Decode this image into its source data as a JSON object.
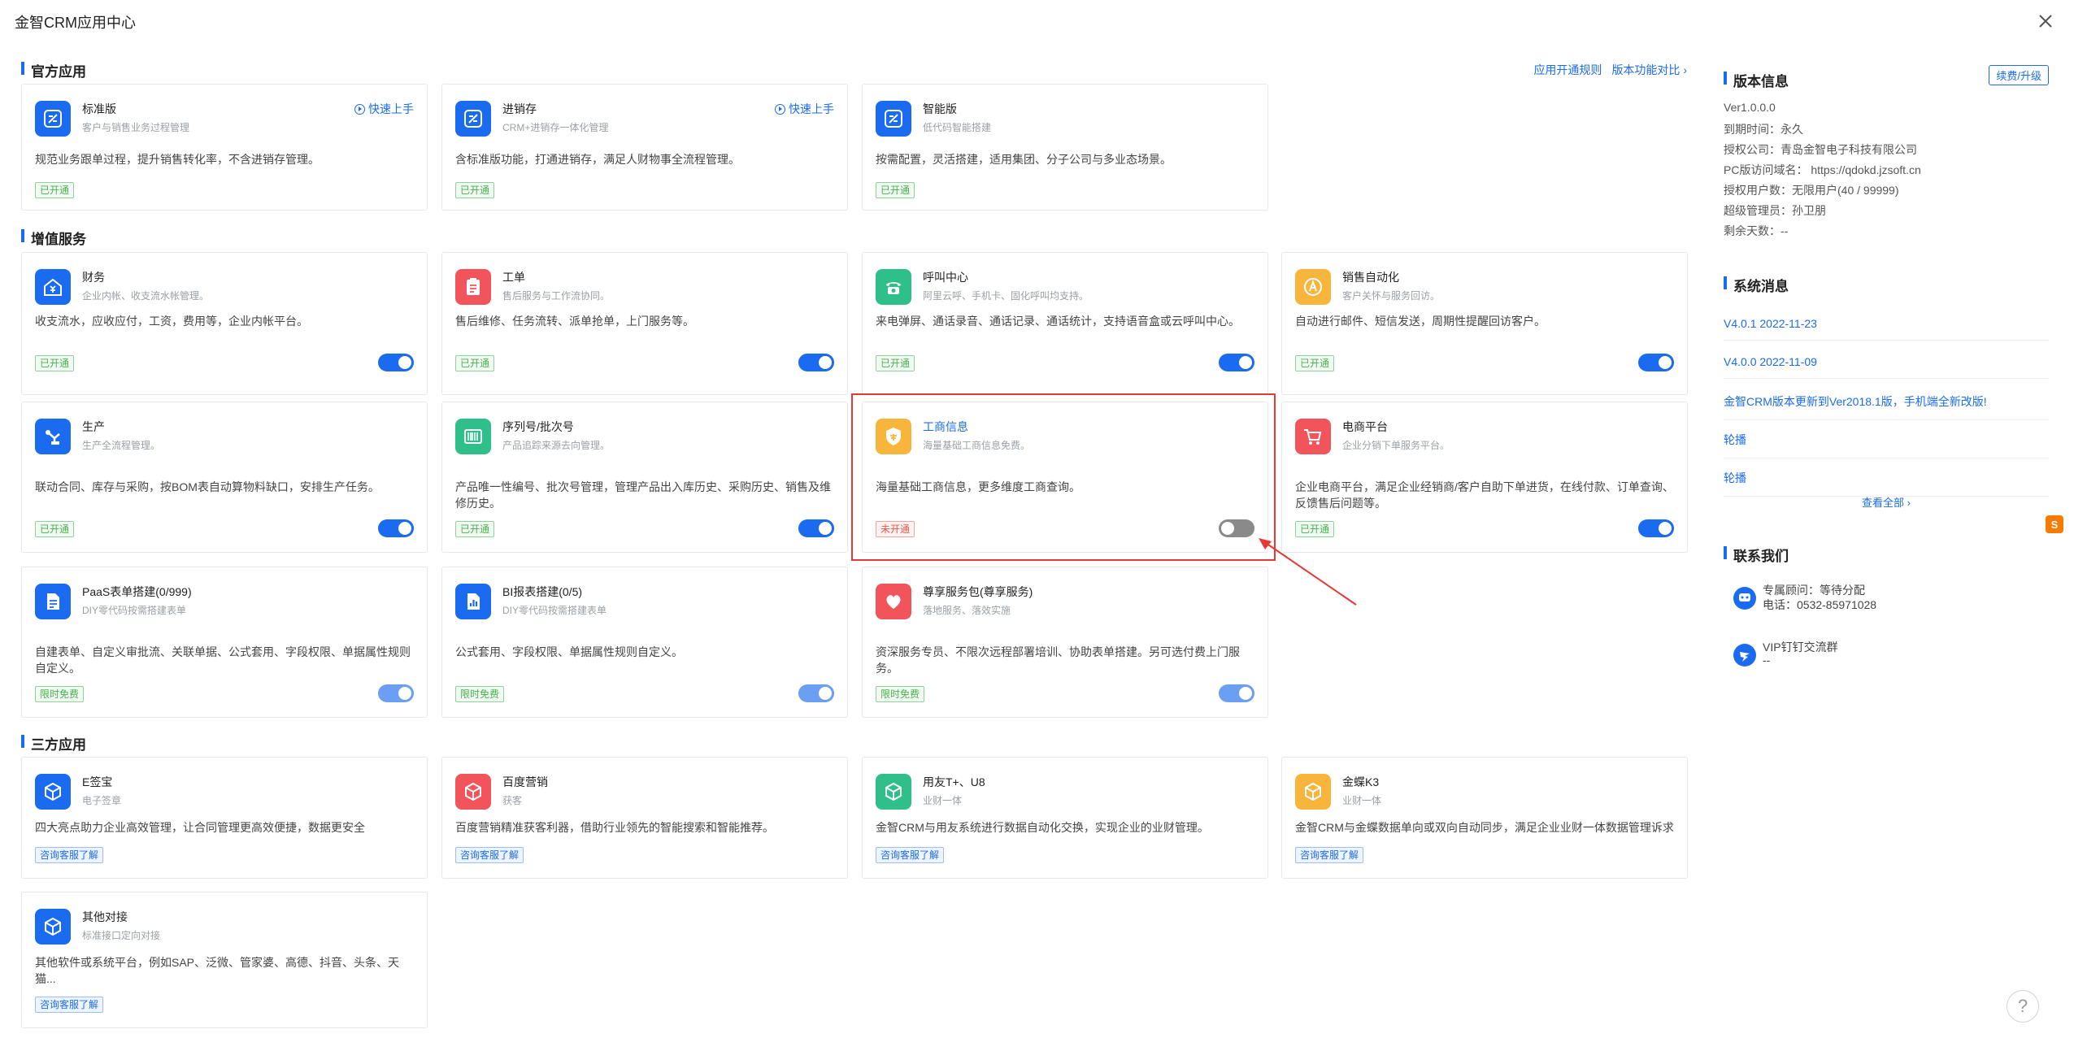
{
  "window": {
    "title": "金智CRM应用中心"
  },
  "links": {
    "rules": "应用开通规则",
    "compare": "版本功能对比"
  },
  "sections": {
    "official": "官方应用",
    "valueadd": "增值服务",
    "thirdparty": "三方应用"
  },
  "labels": {
    "opened": "已开通",
    "not_opened": "未开通",
    "free": "限时免费",
    "consult": "咨询客服了解",
    "quick_start": "快速上手"
  },
  "official": [
    {
      "name": "标准版",
      "sub": "客户与销售业务过程管理",
      "desc": "规范业务跟单过程，提升销售转化率，不含进销存管理。",
      "color": "#1a6bf0",
      "icon": "app-logo-icon"
    },
    {
      "name": "进销存",
      "sub": "CRM+进销存一体化管理",
      "desc": "含标准版功能，打通进销存，满足人财物事全流程管理。",
      "color": "#1a6bf0",
      "icon": "app-logo-icon"
    },
    {
      "name": "智能版",
      "sub": "低代码智能搭建",
      "desc": "按需配置，灵活搭建，适用集团、分子公司与多业态场景。",
      "color": "#1a6bf0",
      "icon": "app-logo-icon"
    }
  ],
  "valueadd": [
    {
      "name": "财务",
      "sub": "企业内帐、收支流水帐管理。",
      "desc": "收支流水，应收应付，工资，费用等，企业内帐平台。",
      "color": "#1a6bf0",
      "icon": "finance-house-icon"
    },
    {
      "name": "工单",
      "sub": "售后服务与工作流协同。",
      "desc": "售后维修、任务流转、派单抢单，上门服务等。",
      "color": "#f2545b",
      "icon": "clipboard-icon"
    },
    {
      "name": "呼叫中心",
      "sub": "阿里云呼、手机卡、固化呼叫均支持。",
      "desc": "来电弹屏、通话录音、通话记录、通话统计，支持语音盒或云呼叫中心。",
      "color": "#2fbf8a",
      "icon": "phone-icon"
    },
    {
      "name": "销售自动化",
      "sub": "客户关怀与服务回访。",
      "desc": "自动进行邮件、短信发送，周期性提醒回访客户。",
      "color": "#f7b53b",
      "icon": "automation-icon"
    },
    {
      "name": "生产",
      "sub": "生产全流程管理。",
      "desc": "联动合同、库存与采购，按BOM表自动算物料缺口，安排生产任务。",
      "color": "#1a6bf0",
      "icon": "robot-arm-icon"
    },
    {
      "name": "序列号/批次号",
      "sub": "产品追踪来源去向管理。",
      "desc": "产品唯一性编号、批次号管理，管理产品出入库历史、采购历史、销售及维修历史。",
      "color": "#2fbf8a",
      "icon": "barcode-icon"
    },
    {
      "name": "工商信息",
      "sub": "海量基础工商信息免费。",
      "desc": "海量基础工商信息，更多维度工商查询。",
      "color": "#f7b53b",
      "icon": "shield-icon"
    },
    {
      "name": "电商平台",
      "sub": "企业分销下单服务平台。",
      "desc": "企业电商平台，满足企业经销商/客户自助下单进货，在线付款、订单查询、反馈售后问题等。",
      "color": "#f2545b",
      "icon": "cart-icon"
    },
    {
      "name": "PaaS表单搭建(0/999)",
      "sub": "DIY零代码按需搭建表单",
      "desc": "自建表单、自定义审批流、关联单据、公式套用、字段权限、单据属性规则自定义。",
      "color": "#1a6bf0",
      "icon": "form-icon"
    },
    {
      "name": "BI报表搭建(0/5)",
      "sub": "DIY零代码按需搭建表单",
      "desc": "公式套用、字段权限、单据属性规则自定义。",
      "color": "#1a6bf0",
      "icon": "report-icon"
    },
    {
      "name": "尊享服务包(尊享服务)",
      "sub": "落地服务、落效实施",
      "desc": "资深服务专员、不限次远程部署培训、协助表单搭建。另可选付费上门服务。",
      "color": "#f2545b",
      "icon": "heart-icon"
    }
  ],
  "thirdparty": [
    {
      "name": "E签宝",
      "sub": "电子签章",
      "desc": "四大亮点助力企业高效管理，让合同管理更高效便捷，数据更安全",
      "color": "#1a6bf0",
      "icon": "cube-icon"
    },
    {
      "name": "百度营销",
      "sub": "获客",
      "desc": "百度营销精准获客利器，借助行业领先的智能搜索和智能推荐。",
      "color": "#f2545b",
      "icon": "cube-icon"
    },
    {
      "name": "用友T+、U8",
      "sub": "业财一体",
      "desc": "金智CRM与用友系统进行数据自动化交换，实现企业的业财管理。",
      "color": "#2fbf8a",
      "icon": "cube-icon"
    },
    {
      "name": "金蝶K3",
      "sub": "业财一体",
      "desc": "金智CRM与金蝶数据单向或双向自动同步，满足企业业财一体数据管理诉求",
      "color": "#f7b53b",
      "icon": "cube-icon"
    },
    {
      "name": "其他对接",
      "sub": "标准接口定向对接",
      "desc": "其他软件或系统平台，例如SAP、泛微、管家婆、高德、抖音、头条、天猫...",
      "color": "#1a6bf0",
      "icon": "cube-icon"
    }
  ],
  "side": {
    "version_title": "版本信息",
    "renew": "续费/升级",
    "version": "Ver1.0.0.0",
    "expire": "到期时间：永久",
    "company": "授权公司：青岛金智电子科技有限公司",
    "domain": "PC版访问域名：  https://qdokd.jzsoft.cn",
    "users": "授权用户数：无限用户(40 / 99999)",
    "admin": "超级管理员：孙卫朋",
    "days": "剩余天数：--",
    "notice_title": "系统消息",
    "notices": [
      "V4.0.1 2022-11-23",
      "V4.0.0 2022-11-09",
      "金智CRM版本更新到Ver2018.1版，手机端全新改版!",
      "轮播",
      "轮播"
    ],
    "view_all": "查看全部",
    "contact_title": "联系我们",
    "advisor": "专属顾问：等待分配",
    "phone": "电话：0532-85971028",
    "vip_group": "VIP钉钉交流群",
    "vip_value": "--"
  }
}
